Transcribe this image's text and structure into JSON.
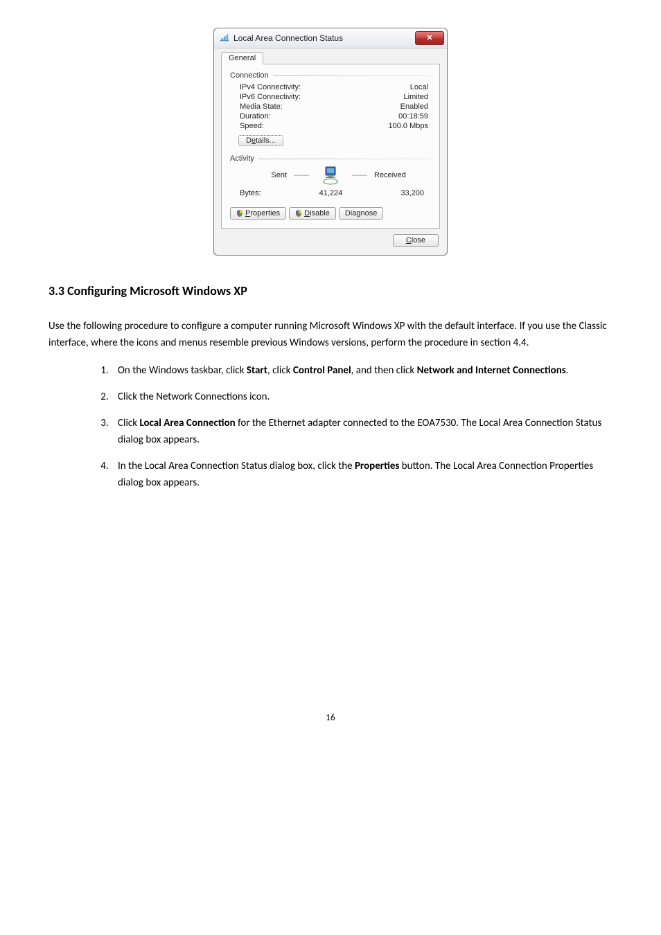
{
  "dialog": {
    "title": "Local Area Connection Status",
    "tab_general": "General",
    "group_connection": "Connection",
    "ipv4_label": "IPv4 Connectivity:",
    "ipv4_value": "Local",
    "ipv6_label": "IPv6 Connectivity:",
    "ipv6_value": "Limited",
    "media_label": "Media State:",
    "media_value": "Enabled",
    "duration_label": "Duration:",
    "duration_value": "00:18:59",
    "speed_label": "Speed:",
    "speed_value": "100.0 Mbps",
    "details_btn_pre": "D",
    "details_btn_post": "tails...",
    "details_btn_key": "e",
    "group_activity": "Activity",
    "sent_label": "Sent",
    "received_label": "Received",
    "bytes_label": "Bytes:",
    "bytes_sent": "41,224",
    "bytes_received": "33,200",
    "properties_btn_key": "P",
    "properties_btn_post": "roperties",
    "disable_btn_key": "D",
    "disable_btn_post": "isable",
    "diagnose_btn_pre": "Dia",
    "diagnose_btn_key": "g",
    "diagnose_btn_post": "nose",
    "close_btn_key": "C",
    "close_btn_post": "lose"
  },
  "doc": {
    "heading": "3.3 Configuring Microsoft Windows XP",
    "para": "Use the following procedure to configure a computer running Microsoft Windows XP with the default interface. If you use the Classic interface, where the icons and menus resemble previous Windows versions, perform the procedure in section 4.4.",
    "li1_a": "On the Windows taskbar, click ",
    "li1_b1": "Start",
    "li1_c": ", click ",
    "li1_b2": "Control Panel",
    "li1_d": ", and then click ",
    "li1_b3": "Network and Internet Connections",
    "li1_e": ".",
    "li2": "Click the Network Connections icon.",
    "li3_a": "Click ",
    "li3_b": "Local Area Connection",
    "li3_c": " for the Ethernet adapter connected to the EOA7530. The Local Area Connection Status dialog box appears.",
    "li4_a": "In the Local Area Connection Status dialog box, click the ",
    "li4_b": "Properties",
    "li4_c": " button. The Local Area Connection Properties dialog box appears.",
    "page_number": "16"
  }
}
